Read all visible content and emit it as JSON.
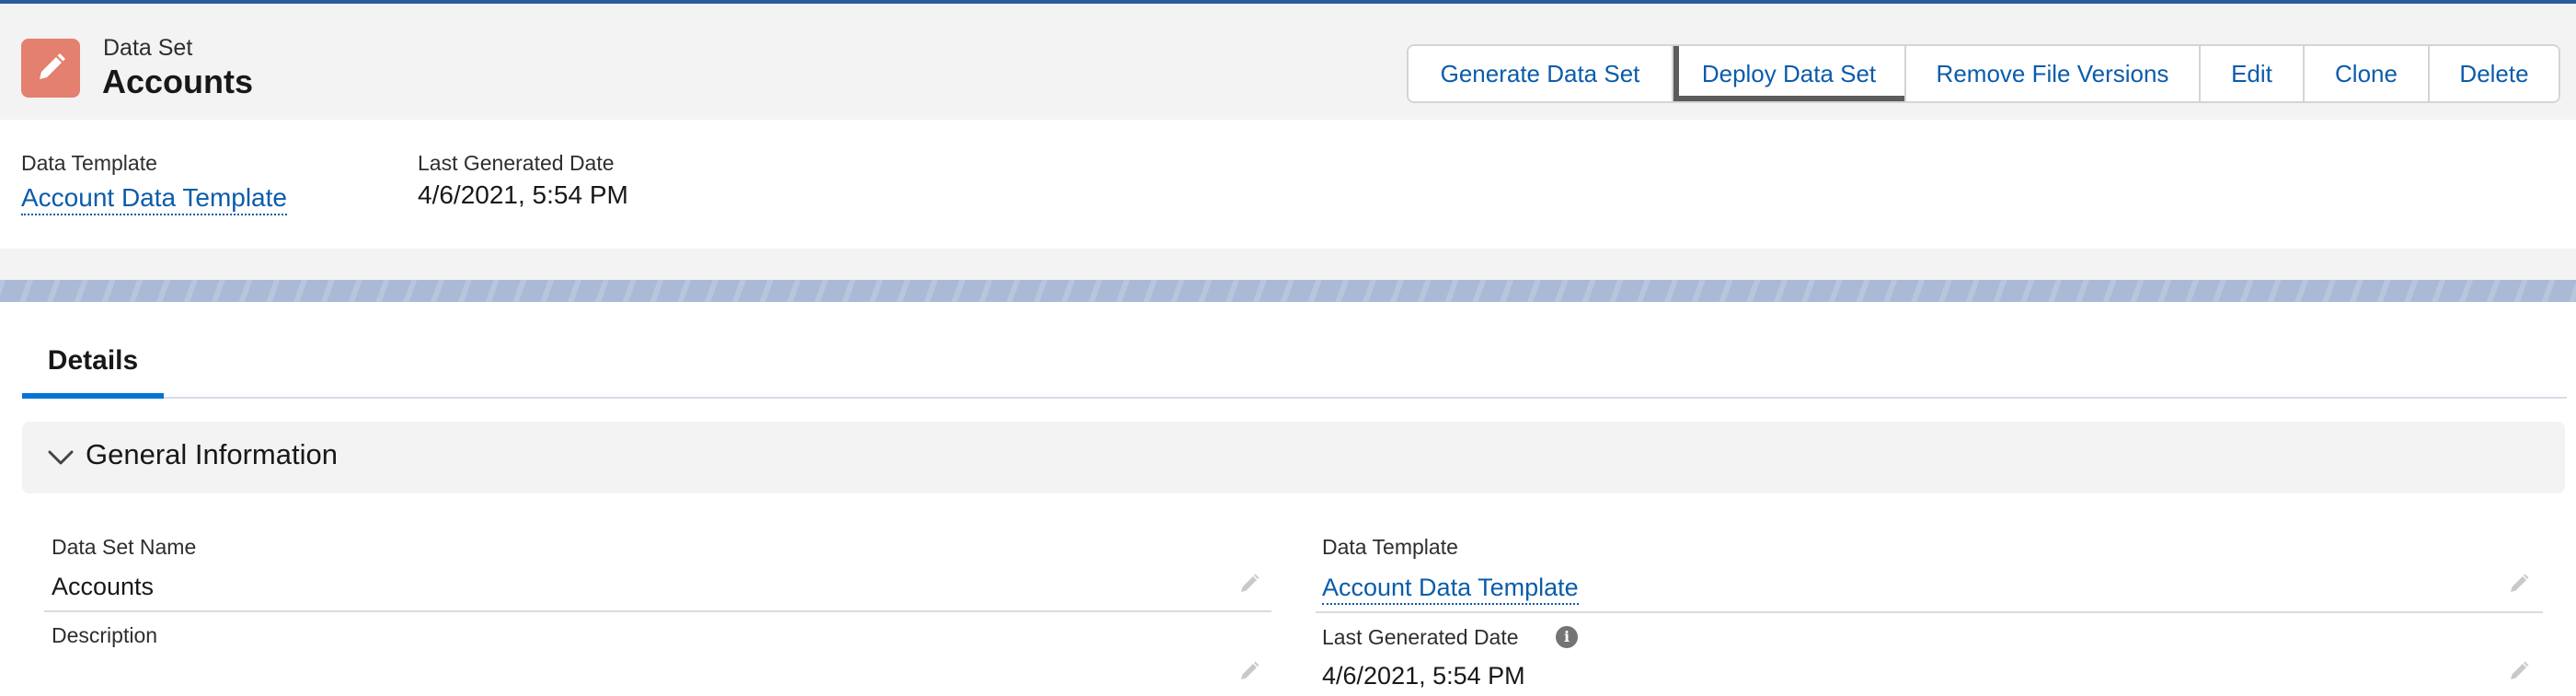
{
  "header": {
    "object_type": "Data Set",
    "record_name": "Accounts",
    "icon": "pencil-icon",
    "icon_color": "#e3806f",
    "actions": [
      {
        "label": "Generate Data Set",
        "name": "generate-data-set-button"
      },
      {
        "label": "Deploy Data Set",
        "name": "deploy-data-set-button"
      },
      {
        "label": "Remove File Versions",
        "name": "remove-file-versions-button"
      },
      {
        "label": "Edit",
        "name": "edit-button"
      },
      {
        "label": "Clone",
        "name": "clone-button"
      },
      {
        "label": "Delete",
        "name": "delete-button"
      }
    ]
  },
  "highlights": {
    "template_label": "Data Template",
    "template_value": "Account Data Template",
    "generated_label": "Last Generated Date",
    "generated_value": "4/6/2021, 5:54 PM"
  },
  "tabs": {
    "details": "Details"
  },
  "section": {
    "title": "General Information",
    "fields": {
      "name_label": "Data Set Name",
      "name_value": "Accounts",
      "description_label": "Description",
      "description_value": "",
      "template_label": "Data Template",
      "template_value": "Account Data Template",
      "generated_label": "Last Generated Date",
      "generated_value": "4/6/2021, 5:54 PM"
    }
  },
  "colors": {
    "link": "#0b5cab",
    "accent": "#0176d3",
    "header_bg": "#f3f3f3"
  }
}
